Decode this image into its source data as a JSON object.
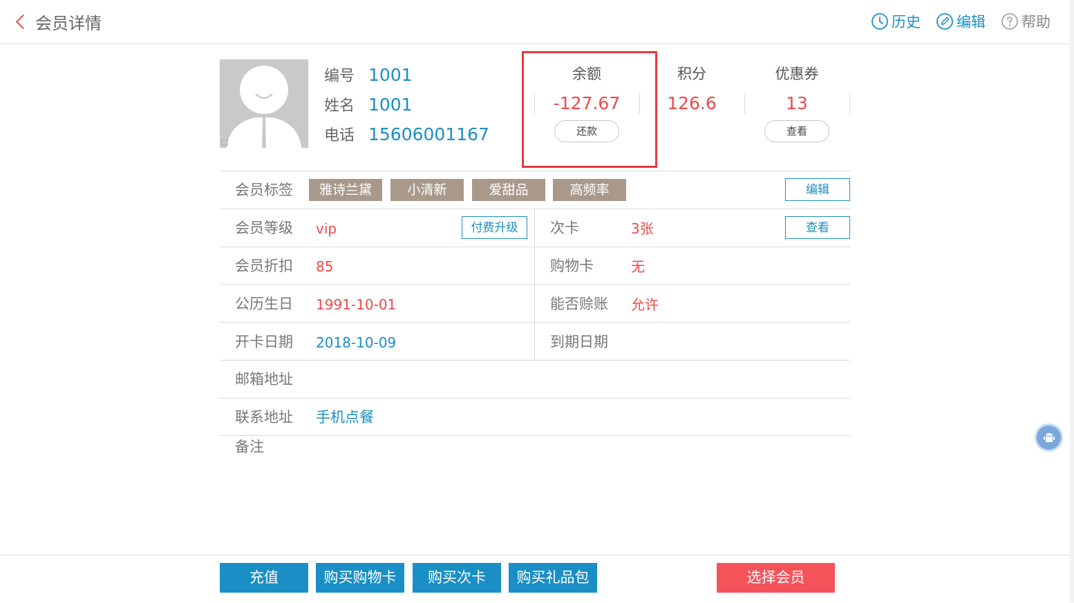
{
  "header": {
    "title": "会员详情",
    "actions": {
      "history": "历史",
      "edit": "编辑",
      "help": "帮助"
    }
  },
  "profile": {
    "id_label": "编号",
    "id_value": "1001",
    "name_label": "姓名",
    "name_value": "1001",
    "phone_label": "电话",
    "phone_value": "15606001167"
  },
  "stats": {
    "balance": {
      "label": "余额",
      "value": "-127.67",
      "button": "还款"
    },
    "points": {
      "label": "积分",
      "value": "126.6"
    },
    "coupons": {
      "label": "优惠券",
      "value": "13",
      "button": "查看"
    }
  },
  "tags": {
    "label": "会员标签",
    "items": [
      "雅诗兰黛",
      "小清新",
      "爱甜品",
      "高频率"
    ],
    "edit_button": "编辑"
  },
  "details": {
    "level_label": "会员等级",
    "level_value": "vip",
    "upgrade_button": "付费升级",
    "times_card_label": "次卡",
    "times_card_value": "3张",
    "times_card_button": "查看",
    "discount_label": "会员折扣",
    "discount_value": "85",
    "shopping_card_label": "购物卡",
    "shopping_card_value": "无",
    "birthday_label": "公历生日",
    "birthday_value": "1991-10-01",
    "credit_label": "能否赊账",
    "credit_value": "允许",
    "open_date_label": "开卡日期",
    "open_date_value": "2018-10-09",
    "expire_label": "到期日期",
    "expire_value": "",
    "email_label": "邮箱地址",
    "email_value": "",
    "address_label": "联系地址",
    "address_value": "手机点餐",
    "remark_label": "备注",
    "remark_value": ""
  },
  "footer": {
    "recharge": "充值",
    "buy_shopping_card": "购买购物卡",
    "buy_times_card": "购买次卡",
    "buy_gift_pack": "购买礼品包",
    "select_member": "选择会员"
  },
  "colors": {
    "accent": "#1a8fc6",
    "danger": "#f04848",
    "tag_bg": "#a8998a",
    "highlight": "#e8383d"
  },
  "icons": [
    "back-chevron-icon",
    "history-clock-icon",
    "edit-pencil-icon",
    "help-question-icon",
    "avatar-placeholder-icon",
    "android-icon"
  ]
}
